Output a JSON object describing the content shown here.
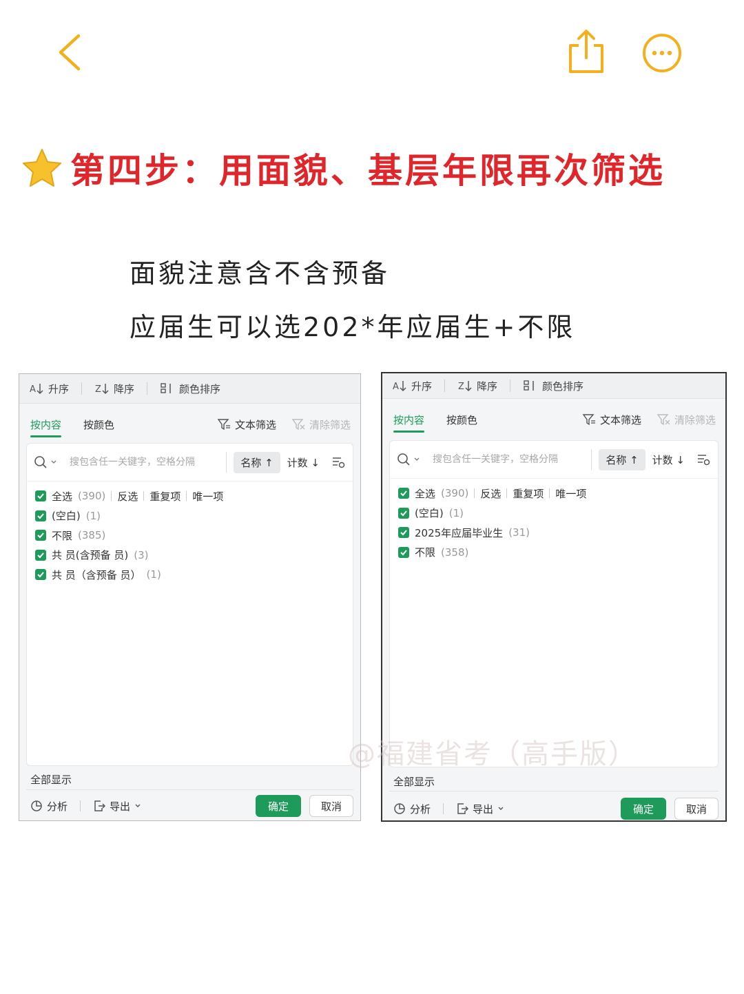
{
  "nav": {
    "back_icon": "chevron-left-icon",
    "share_icon": "share-icon",
    "more_icon": "more-dots-icon",
    "accent": "#f3b01c"
  },
  "heading": {
    "icon": "star-icon",
    "text": "第四步：用面貌、基层年限再次筛选",
    "color": "#e0262a"
  },
  "notes": [
    "面貌注意含不含预备",
    "应届生可以选202*年应届生+不限"
  ],
  "panels": [
    {
      "toolbar": [
        "升序",
        "降序",
        "颜色排序"
      ],
      "tabs": [
        "按内容",
        "按颜色"
      ],
      "text_filter": "文本筛选",
      "clear_filter": "清除筛选",
      "search_placeholder": "搜包含任一关键字，空格分隔",
      "sort_name": "名称 ↑",
      "sort_count": "计数 ↓",
      "select_all": "全选",
      "select_all_count": "(390)",
      "invert": "反选",
      "duplicates": "重复项",
      "unique": "唯一项",
      "items": [
        {
          "label": "(空白)",
          "count": "(1)"
        },
        {
          "label": "不限",
          "count": "(385)"
        },
        {
          "label": "共  员(含预备  员)",
          "count": "(3)"
        },
        {
          "label": "共  员（含预备  员）",
          "count": "(1)"
        }
      ],
      "show_all": "全部显示",
      "analyze": "分析",
      "export": "导出",
      "ok": "确定",
      "cancel": "取消"
    },
    {
      "toolbar": [
        "升序",
        "降序",
        "颜色排序"
      ],
      "tabs": [
        "按内容",
        "按颜色"
      ],
      "text_filter": "文本筛选",
      "clear_filter": "清除筛选",
      "search_placeholder": "搜包含任一关键字，空格分隔",
      "sort_name": "名称 ↑",
      "sort_count": "计数 ↓",
      "select_all": "全选",
      "select_all_count": "(390)",
      "invert": "反选",
      "duplicates": "重复项",
      "unique": "唯一项",
      "items": [
        {
          "label": "(空白)",
          "count": "(1)"
        },
        {
          "label": "2025年应届毕业生",
          "count": "(31)"
        },
        {
          "label": "不限",
          "count": "(358)"
        }
      ],
      "show_all": "全部显示",
      "analyze": "分析",
      "export": "导出",
      "ok": "确定",
      "cancel": "取消",
      "watermark": "@福建省考（高手版）"
    }
  ],
  "colors": {
    "green": "#1e9b5a",
    "title_red": "#e0262a",
    "nav_orange": "#f3b01c"
  }
}
